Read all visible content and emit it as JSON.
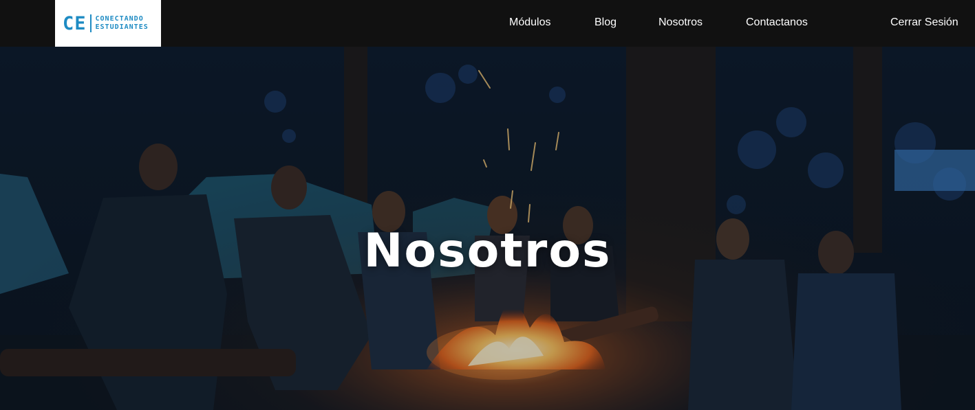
{
  "brand": {
    "logo_mark": "CE",
    "logo_line1": "CONECTANDO",
    "logo_line2": "ESTUDIANTES",
    "color": "#1e8bc3"
  },
  "nav": {
    "items": [
      {
        "label": "Módulos"
      },
      {
        "label": "Blog"
      },
      {
        "label": "Nosotros"
      },
      {
        "label": "Contactanos"
      }
    ],
    "logout_label": "Cerrar Sesión"
  },
  "hero": {
    "title": "Nosotros",
    "image_icon": "campfire-photo"
  }
}
